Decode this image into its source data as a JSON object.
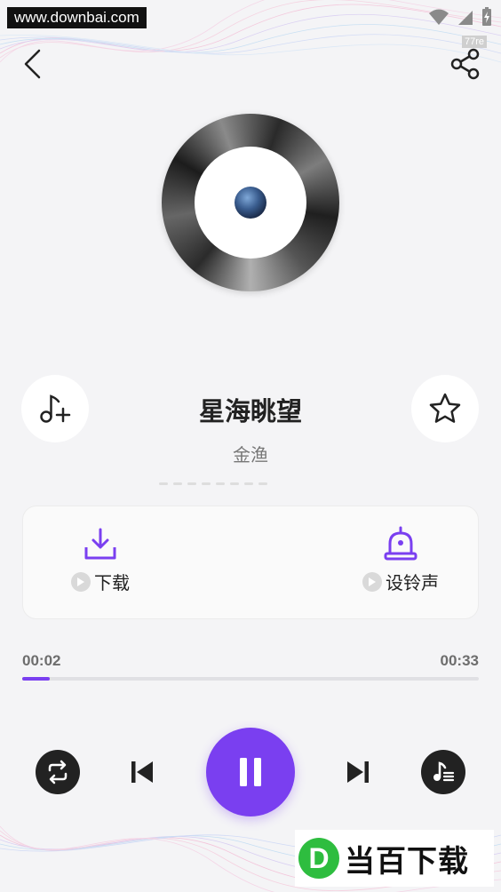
{
  "watermark": {
    "text": "www.downbai.com"
  },
  "status_bar": {
    "badge": "77re"
  },
  "header": {
    "back_icon": "chevron-left-icon",
    "share_icon": "share-icon"
  },
  "song": {
    "title": "星海眺望",
    "artist": "金渔"
  },
  "actions": {
    "add_icon": "music-note-plus-icon",
    "favorite_icon": "star-icon",
    "download_label": "下载",
    "ringtone_label": "设铃声"
  },
  "player": {
    "current_time": "00:02",
    "total_time": "00:33",
    "progress": 0.06,
    "state": "playing"
  },
  "colors": {
    "accent": "#7a3ff0",
    "dark_button": "#222222",
    "background": "#f4f4f6"
  },
  "site_logo": {
    "mark": "D",
    "text": "当百下载"
  }
}
